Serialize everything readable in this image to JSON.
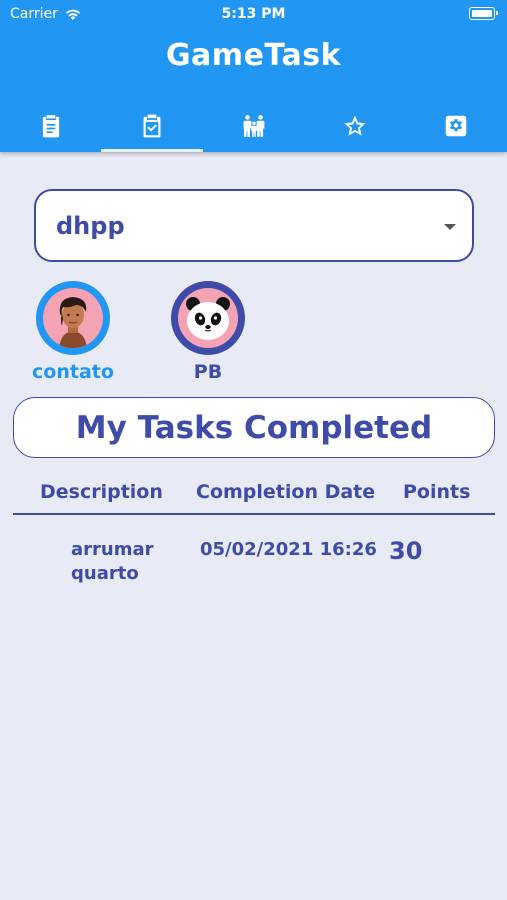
{
  "status_bar": {
    "carrier": "Carrier",
    "time": "5:13 PM"
  },
  "header": {
    "title": "GameTask",
    "background_color": "#2196F3"
  },
  "tabs": [
    {
      "icon": "clipboard-list-icon",
      "active": false
    },
    {
      "icon": "clipboard-check-icon",
      "active": true
    },
    {
      "icon": "family-icon",
      "active": false
    },
    {
      "icon": "star-icon",
      "active": false
    },
    {
      "icon": "settings-icon",
      "active": false
    }
  ],
  "group_select": {
    "value": "dhpp"
  },
  "members": [
    {
      "name": "contato",
      "avatar": "man-avatar",
      "ring_color": "#2196F3",
      "selected": true
    },
    {
      "name": "PB",
      "avatar": "panda-avatar",
      "ring_color": "#3F4BA8",
      "selected": false
    }
  ],
  "section_title": "My Tasks Completed",
  "table": {
    "columns": [
      "Description",
      "Completion Date",
      "Points"
    ],
    "rows": [
      {
        "description_line1": "arrumar",
        "description_line2": "quarto",
        "completion_date": "05/02/2021 16:26",
        "points": "30"
      }
    ]
  },
  "colors": {
    "accent": "#3F4BA8",
    "background": "#E8EAF6",
    "selected_member": "#2196F3"
  }
}
